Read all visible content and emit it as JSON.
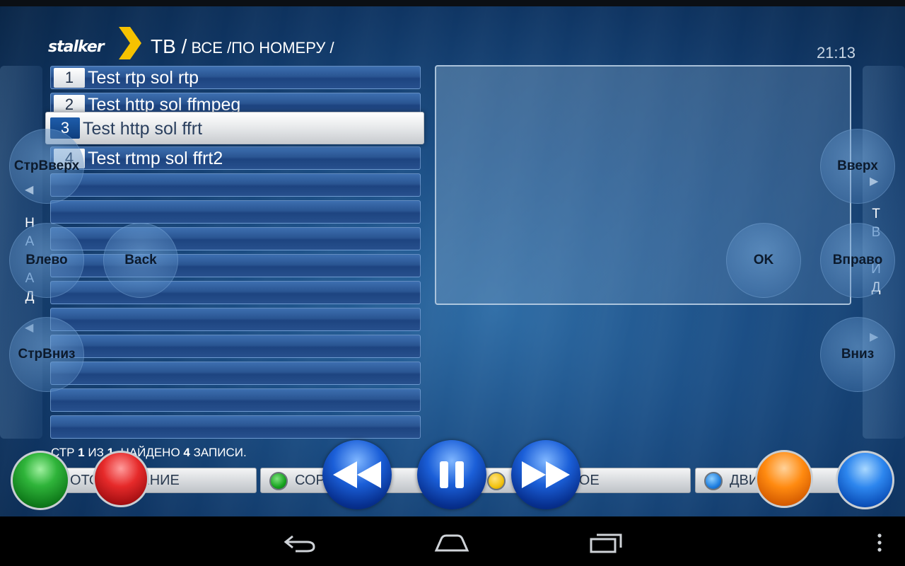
{
  "header": {
    "logo_text": "stalker",
    "breadcrumb_main": "ТВ /",
    "breadcrumb_sub": " ВСЕ /ПО НОМЕРУ /",
    "clock": "21:13"
  },
  "channels": [
    {
      "number": "1",
      "title": "Test rtp sol rtp"
    },
    {
      "number": "2",
      "title": "Test http sol ffmpeg"
    },
    {
      "number": "3",
      "title": "Test http sol ffrt",
      "selected": true
    },
    {
      "number": "4",
      "title": "Test rtmp sol ffrt2"
    }
  ],
  "status": {
    "p1": "СТР ",
    "page": "1",
    "p2": " ИЗ ",
    "total": "1",
    "p3": ", НАЙДЕНО ",
    "found": "4",
    "p4": " ЗАПИСИ."
  },
  "controls": {
    "page_up": "СтрВверх",
    "page_down": "СтрВниз",
    "left": "Влево",
    "back": "Back",
    "ok": "OK",
    "up": "Вверх",
    "right": "Вправо",
    "down": "Вниз"
  },
  "side_left_letters": [
    "Н",
    "А",
    "З",
    "А",
    "Д"
  ],
  "side_right_letters": [
    "Т",
    "В",
    "Г",
    "И",
    "Д"
  ],
  "function_bar": {
    "btn1": "ОТОБРАЖЕНИЕ",
    "btn2": "СОРТИРОВКА",
    "btn3": "ИЗБРАННОЕ",
    "btn4": "ДВИГАТЬ"
  },
  "colors": {
    "green": "#22a12c",
    "red": "#e0262a",
    "yellow": "#f2c20e",
    "blue": "#1f7fe0",
    "orange": "#ff8a10"
  },
  "media": {
    "rewind_icon": "rewind-icon",
    "pause_icon": "pause-icon",
    "forward_icon": "fast-forward-icon"
  }
}
